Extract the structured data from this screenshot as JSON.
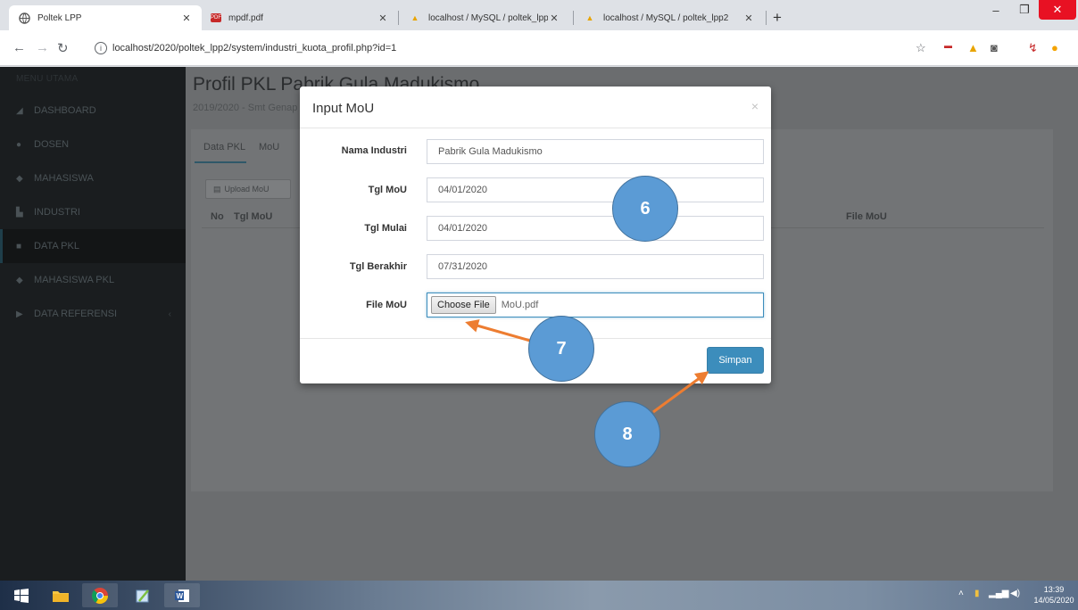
{
  "browser": {
    "tabs": [
      {
        "title": "Poltek LPP",
        "active": true
      },
      {
        "title": "mpdf.pdf",
        "active": false
      },
      {
        "title": "localhost / MySQL / poltek_lpp2",
        "active": false
      },
      {
        "title": "localhost / MySQL / poltek_lpp2",
        "active": false
      }
    ],
    "new_tab": "+",
    "url": "localhost/2020/poltek_lpp2/system/industri_kuota_profil.php?id=1"
  },
  "sidebar": {
    "header": "MENU UTAMA",
    "items": [
      {
        "label": "DASHBOARD",
        "icon": "tachometer-icon"
      },
      {
        "label": "DOSEN",
        "icon": "user-icon"
      },
      {
        "label": "MAHASISWA",
        "icon": "users-icon"
      },
      {
        "label": "INDUSTRI",
        "icon": "industry-icon"
      },
      {
        "label": "DATA PKL",
        "icon": "book-icon"
      },
      {
        "label": "MAHASISWA PKL",
        "icon": "users-icon"
      },
      {
        "label": "DATA REFERENSI",
        "icon": "folder-icon"
      }
    ]
  },
  "page": {
    "title": "Profil PKL Pabrik Gula Madukismo",
    "subtitle": "2019/2020 - Smt Genap",
    "tabs": [
      "Data PKL",
      "MoU"
    ],
    "upload_button": "Upload MoU",
    "table_headers": [
      "No",
      "Tgl MoU",
      "File MoU"
    ]
  },
  "modal": {
    "title": "Input MoU",
    "close": "×",
    "fields": [
      {
        "label": "Nama Industri",
        "value": "Pabrik Gula Madukismo"
      },
      {
        "label": "Tgl MoU",
        "value": "04/01/2020"
      },
      {
        "label": "Tgl Mulai",
        "value": "04/01/2020"
      },
      {
        "label": "Tgl Berakhir",
        "value": "07/31/2020"
      }
    ],
    "file_label": "File MoU",
    "choose_file": "Choose File",
    "file_name": "MoU.pdf",
    "save_button": "Simpan"
  },
  "callouts": [
    "6",
    "7",
    "8"
  ],
  "taskbar": {
    "time": "13:39",
    "date": "14/05/2020"
  },
  "colors": {
    "accent": "#3c8dbc",
    "callout_fill": "#5b9bd5",
    "arrow": "#ed7d31",
    "window_close": "#e81123"
  }
}
